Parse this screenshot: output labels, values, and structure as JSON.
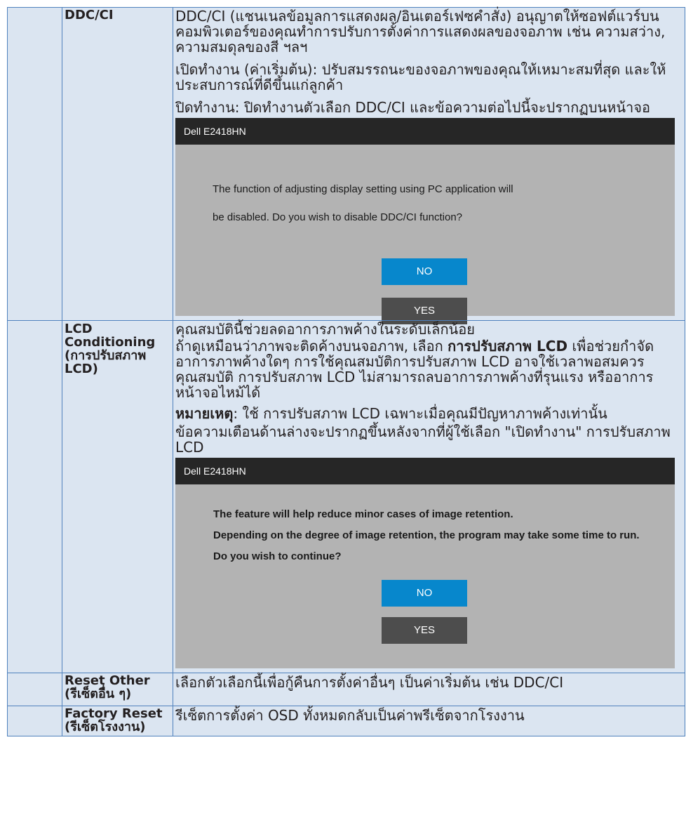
{
  "rows": [
    {
      "label": "DDC/CI",
      "paragraphs": [
        "DDC/CI (แชนเนลข้อมูลการแสดงผล/อินเตอร์เฟซคำสั่ง) อนุญาตให้ซอฟต์แวร์บนคอมพิวเตอร์ของคุณทำการปรับการตั้งค่าการแสดงผลของจอภาพ เช่น ความสว่าง, ความสมดุลของสี ฯลฯ",
        "เปิดทำงาน (ค่าเริ่มต้น): ปรับสมรรถนะของจอภาพของคุณให้เหมาะสมที่สุด และให้ประสบการณ์ที่ดีขึ้นแก่ลูกค้า",
        "ปิดทำงาน: ปิดทำงานตัวเลือก DDC/CI และข้อความต่อไปนี้จะปรากฏบนหน้าจอ"
      ],
      "dialog": {
        "title": "Dell E2418HN",
        "lines": [
          "The function of adjusting display setting using PC application will",
          "be disabled. Do you wish to disable DDC/CI function?"
        ],
        "no_label": "NO",
        "yes_label": "YES"
      }
    },
    {
      "label": "LCD Conditioning (การปรับสภาพ LCD)",
      "intro": "คุณสมบัตินี้ช่วยลดอาการภาพค้างในระดับเล็กน้อย",
      "p2_before": "ถ้าดูเหมือนว่าภาพจะติดค้างบนจอภาพ, เลือก ",
      "p2_bold": "การปรับสภาพ LCD",
      "p2_after": " เพื่อช่วยกำจัดอาการภาพค้างใดๆ การใช้คุณสมบัติการปรับสภาพ LCD อาจใช้เวลาพอสมควร คุณสมบัติ การปรับสภาพ LCD ไม่สามารถลบอาการภาพค้างที่รุนแรง หรืออาการหน้าจอไหม้ได้",
      "note_bold": "หมายเหตุ",
      "note_rest": ": ใช้ การปรับสภาพ LCD เฉพาะเมื่อคุณมีปัญหาภาพค้างเท่านั้น",
      "warning": "ข้อความเตือนด้านล่างจะปรากฏขึ้นหลังจากที่ผู้ใช้เลือก \"เปิดทำงาน\" การปรับสภาพ LCD",
      "dialog": {
        "title": "Dell E2418HN",
        "lines": [
          "The feature will help reduce minor cases of image retention.",
          "Depending on the degree of image retention, the program may take some time to run.",
          "Do you wish to continue?"
        ],
        "no_label": "NO",
        "yes_label": "YES"
      }
    },
    {
      "label": "Reset Other (รีเซ็ตอื่น ๆ)",
      "text": "เลือกตัวเลือกนี้เพื่อกู้คืนการตั้งค่าอื่นๆ เป็นค่าเริ่มต้น เช่น DDC/CI"
    },
    {
      "label": "Factory Reset (รีเซ็ตโรงงาน)",
      "text": "รีเซ็ตการตั้งค่า OSD ทั้งหมดกลับเป็นค่าพรีเซ็ตจากโรงงาน"
    }
  ]
}
